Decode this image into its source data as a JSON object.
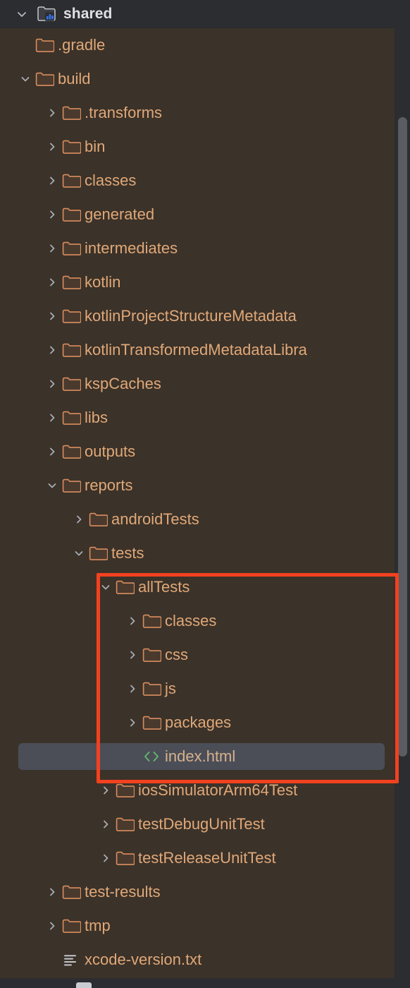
{
  "panel": {
    "background_color": "#3b3229",
    "header_background_color": "#2b2d30",
    "folder_color": "#d98d5f",
    "text_color": "#e0a878",
    "selection_color": "#4b4e57",
    "annotation_color": "#f2411f",
    "module_icon_accent": "#3574f0"
  },
  "header": {
    "twisty": "chevron-down",
    "icon": "module-folder-icon",
    "title": "shared"
  },
  "tree": {
    "items": [
      {
        "label": ".gradle",
        "depth": 1,
        "twisty": "none",
        "icon": "folder-icon",
        "selected": false
      },
      {
        "label": "build",
        "depth": 1,
        "twisty": "chevron-down",
        "icon": "folder-icon",
        "selected": false
      },
      {
        "label": ".transforms",
        "depth": 2,
        "twisty": "chevron-right",
        "icon": "folder-icon",
        "selected": false
      },
      {
        "label": "bin",
        "depth": 2,
        "twisty": "chevron-right",
        "icon": "folder-icon",
        "selected": false
      },
      {
        "label": "classes",
        "depth": 2,
        "twisty": "chevron-right",
        "icon": "folder-icon",
        "selected": false
      },
      {
        "label": "generated",
        "depth": 2,
        "twisty": "chevron-right",
        "icon": "folder-icon",
        "selected": false
      },
      {
        "label": "intermediates",
        "depth": 2,
        "twisty": "chevron-right",
        "icon": "folder-icon",
        "selected": false
      },
      {
        "label": "kotlin",
        "depth": 2,
        "twisty": "chevron-right",
        "icon": "folder-icon",
        "selected": false
      },
      {
        "label": "kotlinProjectStructureMetadata",
        "depth": 2,
        "twisty": "chevron-right",
        "icon": "folder-icon",
        "selected": false
      },
      {
        "label": "kotlinTransformedMetadataLibra",
        "depth": 2,
        "twisty": "chevron-right",
        "icon": "folder-icon",
        "selected": false
      },
      {
        "label": "kspCaches",
        "depth": 2,
        "twisty": "chevron-right",
        "icon": "folder-icon",
        "selected": false
      },
      {
        "label": "libs",
        "depth": 2,
        "twisty": "chevron-right",
        "icon": "folder-icon",
        "selected": false
      },
      {
        "label": "outputs",
        "depth": 2,
        "twisty": "chevron-right",
        "icon": "folder-icon",
        "selected": false
      },
      {
        "label": "reports",
        "depth": 2,
        "twisty": "chevron-down",
        "icon": "folder-icon",
        "selected": false
      },
      {
        "label": "androidTests",
        "depth": 3,
        "twisty": "chevron-right",
        "icon": "folder-icon",
        "selected": false
      },
      {
        "label": "tests",
        "depth": 3,
        "twisty": "chevron-down",
        "icon": "folder-icon",
        "selected": false
      },
      {
        "label": "allTests",
        "depth": 4,
        "twisty": "chevron-down",
        "icon": "folder-icon",
        "selected": false
      },
      {
        "label": "classes",
        "depth": 5,
        "twisty": "chevron-right",
        "icon": "folder-icon",
        "selected": false
      },
      {
        "label": "css",
        "depth": 5,
        "twisty": "chevron-right",
        "icon": "folder-icon",
        "selected": false
      },
      {
        "label": "js",
        "depth": 5,
        "twisty": "chevron-right",
        "icon": "folder-icon",
        "selected": false
      },
      {
        "label": "packages",
        "depth": 5,
        "twisty": "chevron-right",
        "icon": "folder-icon",
        "selected": false
      },
      {
        "label": "index.html",
        "depth": 5,
        "twisty": "none",
        "icon": "html-file-icon",
        "selected": true
      },
      {
        "label": "iosSimulatorArm64Test",
        "depth": 4,
        "twisty": "chevron-right",
        "icon": "folder-icon",
        "selected": false
      },
      {
        "label": "testDebugUnitTest",
        "depth": 4,
        "twisty": "chevron-right",
        "icon": "folder-icon",
        "selected": false
      },
      {
        "label": "testReleaseUnitTest",
        "depth": 4,
        "twisty": "chevron-right",
        "icon": "folder-icon",
        "selected": false
      },
      {
        "label": "test-results",
        "depth": 2,
        "twisty": "chevron-right",
        "icon": "folder-icon",
        "selected": false
      },
      {
        "label": "tmp",
        "depth": 2,
        "twisty": "chevron-right",
        "icon": "folder-icon",
        "selected": false
      },
      {
        "label": "xcode-version.txt",
        "depth": 2,
        "twisty": "none",
        "icon": "text-file-icon",
        "selected": false
      }
    ]
  },
  "annotation": {
    "shape": "rectangle",
    "color": "#f2411f",
    "encloses": [
      "allTests",
      "classes",
      "css",
      "js",
      "packages",
      "index.html"
    ]
  },
  "scrollbar": {
    "orientation": "vertical",
    "thumb_color": "#595c61"
  }
}
